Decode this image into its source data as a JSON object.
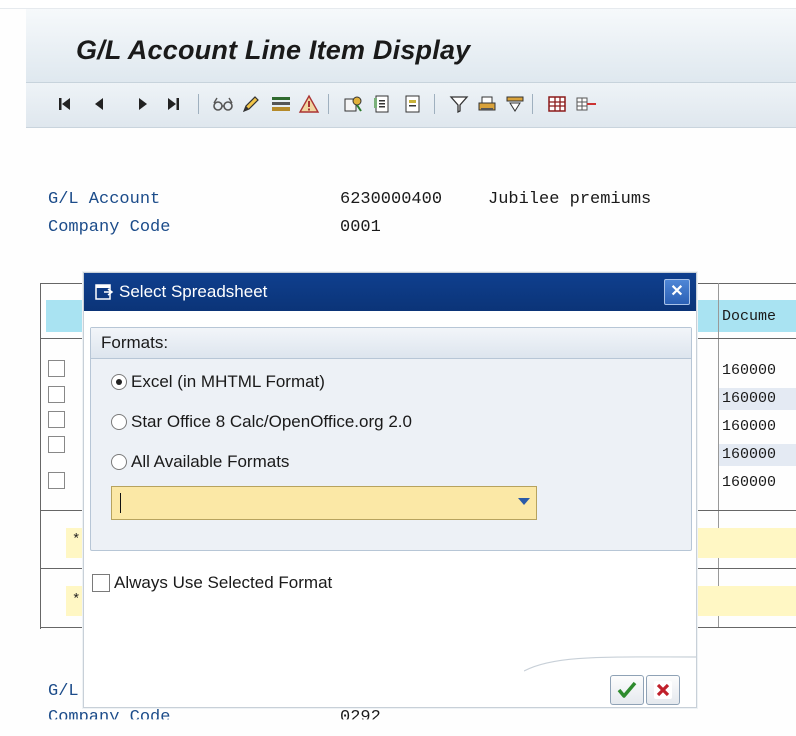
{
  "window": {
    "title": "G/L Account Line Item Display"
  },
  "toolbar": {
    "icons": [
      "first-page-icon",
      "previous-page-icon",
      "next-page-icon",
      "last-page-icon",
      "glasses-icon",
      "pencil-icon",
      "layout-icon",
      "warning-icon",
      "document-icon",
      "document-display-icon",
      "note-icon",
      "filter-icon",
      "print-icon",
      "sum-icon",
      "spreadsheet-icon",
      "insert-column-icon"
    ]
  },
  "header": {
    "gl_account_label": "G/L Account",
    "gl_account_value": "6230000400",
    "gl_account_desc": "Jubilee premiums",
    "company_code_label": "Company Code",
    "company_code_value": "0001"
  },
  "table": {
    "doc_header": "Docume",
    "doc_values": [
      "160000",
      "160000",
      "160000",
      "160000",
      "160000"
    ],
    "star": "*"
  },
  "footer": {
    "gl_label": "G/L",
    "company_code_label": "Company Code",
    "company_code_value": "0292"
  },
  "dialog": {
    "title": "Select Spreadsheet",
    "formats_label": "Formats:",
    "options": [
      "Excel (in MHTML Format)",
      "Star Office 8 Calc/OpenOffice.org 2.0",
      "All Available Formats"
    ],
    "selected_option": 0,
    "format_value": "",
    "always_use_label": "Always Use Selected Format",
    "always_use_checked": false
  }
}
